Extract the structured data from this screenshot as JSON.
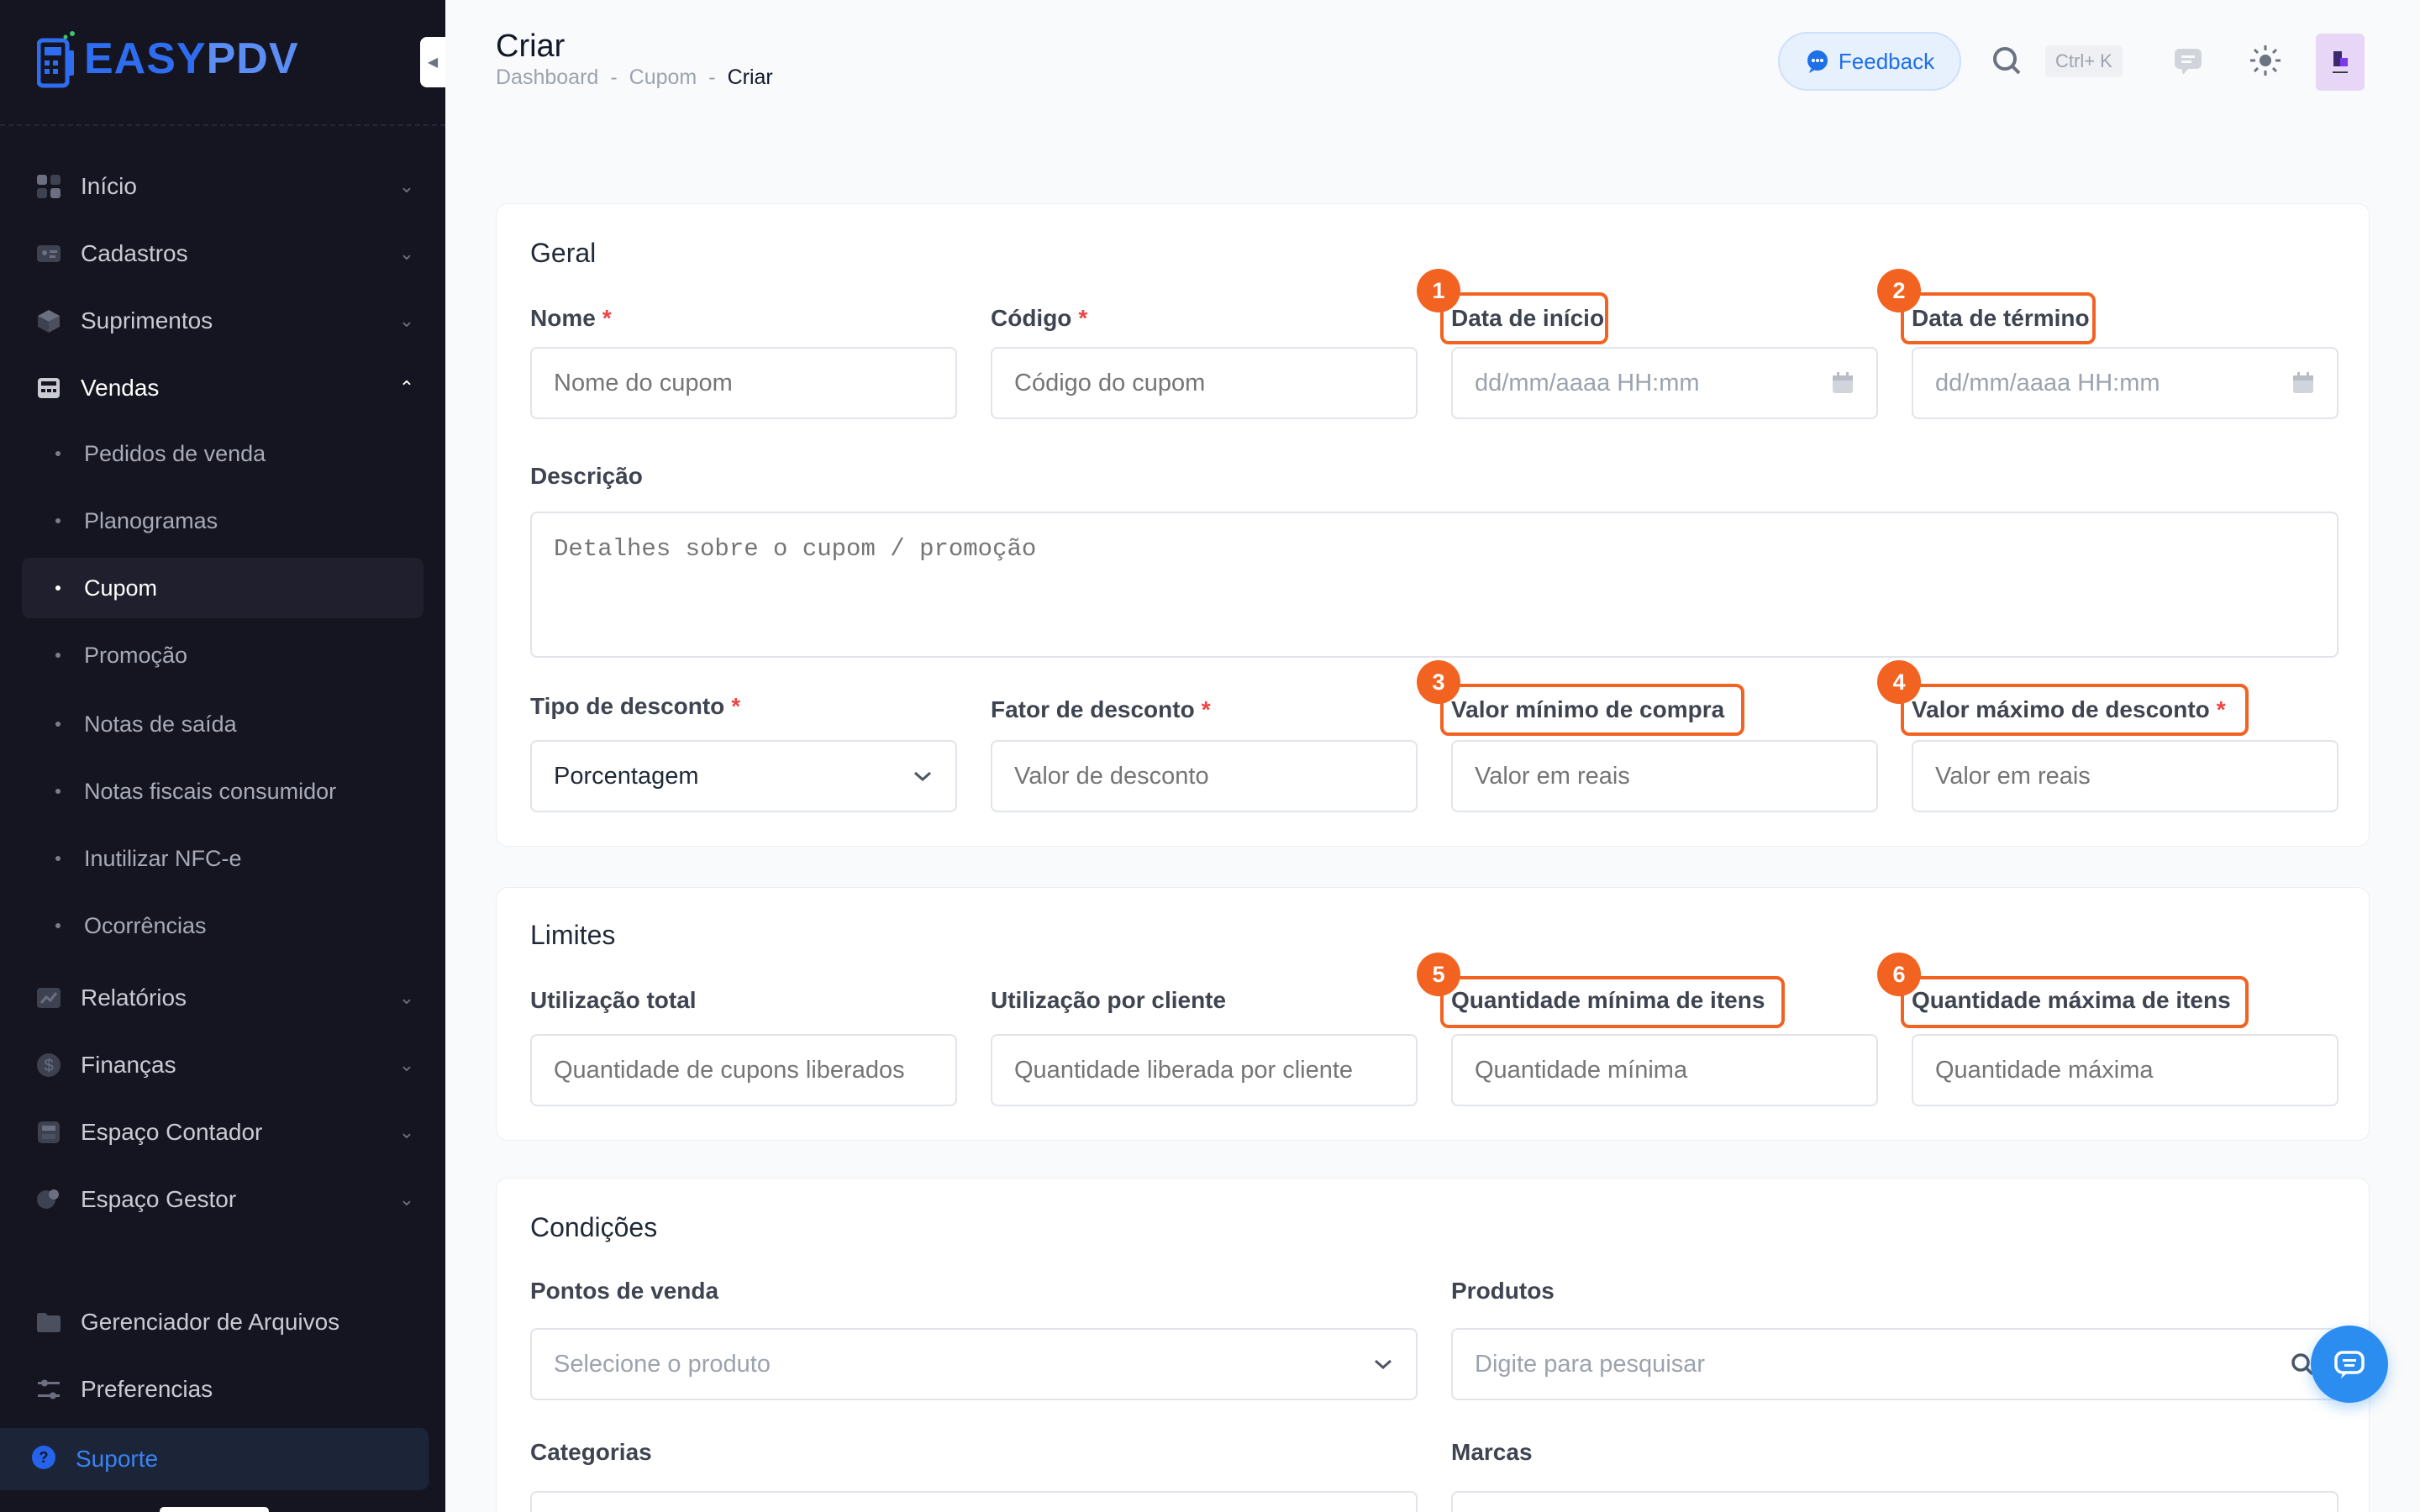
{
  "app": {
    "brand_prefix": "EASY",
    "brand_suffix": "PDV"
  },
  "sidebar": {
    "items": [
      {
        "label": "Início",
        "icon": "grid-icon"
      },
      {
        "label": "Cadastros",
        "icon": "id-card-icon"
      },
      {
        "label": "Suprimentos",
        "icon": "box-icon"
      },
      {
        "label": "Vendas",
        "icon": "register-icon",
        "expanded": true
      },
      {
        "label": "Relatórios",
        "icon": "chart-icon"
      },
      {
        "label": "Finanças",
        "icon": "dollar-icon"
      },
      {
        "label": "Espaço Contador",
        "icon": "calculator-icon"
      },
      {
        "label": "Espaço Gestor",
        "icon": "manager-icon"
      }
    ],
    "sub_items": [
      {
        "label": "Pedidos de venda"
      },
      {
        "label": "Planogramas"
      },
      {
        "label": "Cupom",
        "active": true
      },
      {
        "label": "Promoção"
      },
      {
        "label": "Notas de saída"
      },
      {
        "label": "Notas fiscais consumidor"
      },
      {
        "label": "Inutilizar NFC-e"
      },
      {
        "label": "Ocorrências"
      }
    ],
    "bottom_items": [
      {
        "label": "Gerenciador de Arquivos",
        "icon": "folder-icon"
      },
      {
        "label": "Preferencias",
        "icon": "sliders-icon"
      }
    ],
    "support": {
      "label": "Suporte",
      "icon": "help-icon"
    }
  },
  "header": {
    "title": "Criar",
    "breadcrumb": [
      "Dashboard",
      "Cupom",
      "Criar"
    ],
    "breadcrumb_sep": "-",
    "feedback_label": "Feedback",
    "shortcut": "Ctrl+ K"
  },
  "geral": {
    "title": "Geral",
    "nome": {
      "label": "Nome",
      "placeholder": "Nome do cupom",
      "required": "*"
    },
    "codigo": {
      "label": "Código",
      "placeholder": "Código do cupom",
      "required": "*"
    },
    "data_inicio": {
      "label": "Data de início",
      "placeholder": "dd/mm/aaaa HH:mm"
    },
    "data_termino": {
      "label": "Data de término",
      "placeholder": "dd/mm/aaaa HH:mm"
    },
    "descricao": {
      "label": "Descrição",
      "placeholder": "Detalhes sobre o cupom / promoção"
    },
    "tipo_desconto": {
      "label": "Tipo de desconto",
      "value": "Porcentagem",
      "required": "*"
    },
    "fator_desconto": {
      "label": "Fator de desconto",
      "placeholder": "Valor de desconto",
      "required": "*"
    },
    "valor_minimo": {
      "label": "Valor mínimo de compra",
      "placeholder": "Valor em reais"
    },
    "valor_maximo": {
      "label": "Valor máximo de desconto",
      "placeholder": "Valor em reais",
      "required": "*"
    }
  },
  "limites": {
    "title": "Limites",
    "utilizacao_total": {
      "label": "Utilização total",
      "placeholder": "Quantidade de cupons liberados"
    },
    "utilizacao_cliente": {
      "label": "Utilização por cliente",
      "placeholder": "Quantidade liberada por cliente"
    },
    "qtd_minima": {
      "label": "Quantidade mínima de itens",
      "placeholder": "Quantidade mínima"
    },
    "qtd_maxima": {
      "label": "Quantidade máxima de itens",
      "placeholder": "Quantidade máxima"
    }
  },
  "condicoes": {
    "title": "Condições",
    "pontos_venda": {
      "label": "Pontos de venda",
      "placeholder": "Selecione o produto"
    },
    "produtos": {
      "label": "Produtos",
      "placeholder": "Digite para pesquisar"
    },
    "categorias": {
      "label": "Categorias"
    },
    "marcas": {
      "label": "Marcas"
    }
  },
  "annotations": [
    "1",
    "2",
    "3",
    "4",
    "5",
    "6"
  ],
  "colors": {
    "accent": "#f26322",
    "primary": "#1e6fe8",
    "sidebar_bg": "#151521"
  }
}
